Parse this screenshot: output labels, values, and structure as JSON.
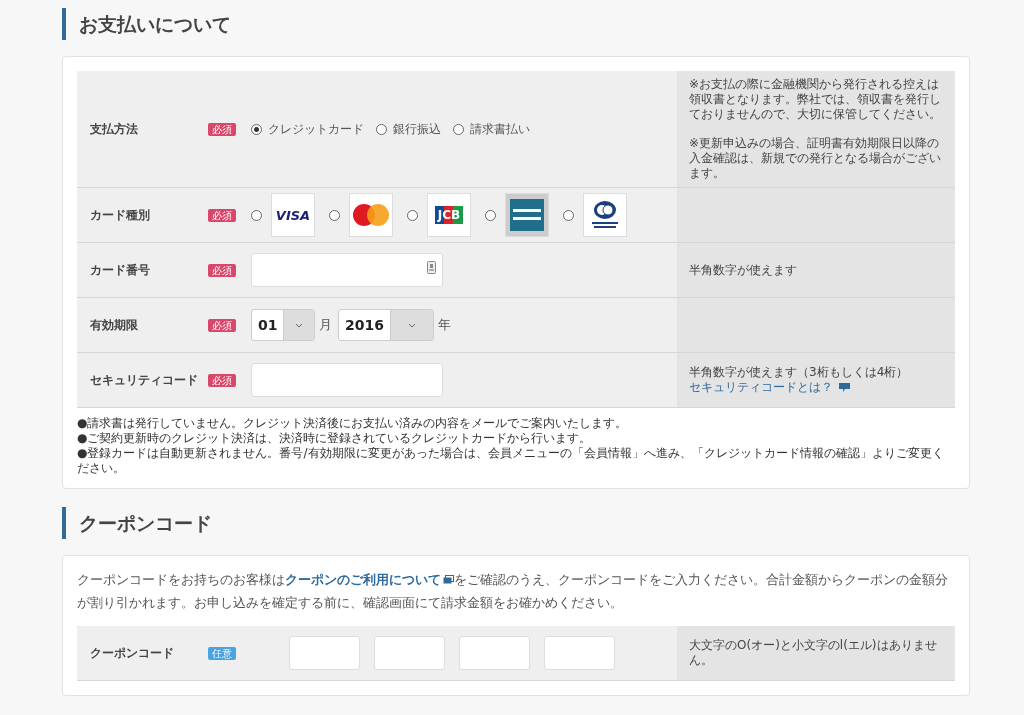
{
  "payment": {
    "title": "お支払いについて",
    "rows": [
      {
        "kind": "radio",
        "label": "支払方法",
        "badge": {
          "kind": "required",
          "text": "必須"
        },
        "options": [
          {
            "label": "クレジットカード",
            "selected": true
          },
          {
            "label": "銀行振込",
            "selected": false
          },
          {
            "label": "請求書払い",
            "selected": false
          }
        ],
        "note": [
          "※お支払の際に金融機関から発行される控えは領収書となります。弊社では、領収書を発行しておりませんので、大切に保管してください。",
          "※更新申込みの場合、証明書有効期限日以降の入金確認は、新規での発行となる場合がございます。"
        ]
      },
      {
        "kind": "cards",
        "label": "カード種別",
        "badge": {
          "kind": "required",
          "text": "必須"
        },
        "cards": [
          {
            "kind": "visa",
            "logo": "VISA",
            "selected": false
          },
          {
            "kind": "master",
            "selected": false
          },
          {
            "kind": "jcb",
            "logo": "JCB",
            "selected": false
          },
          {
            "kind": "amex",
            "selected": false
          },
          {
            "kind": "diners",
            "selected": false
          }
        ]
      },
      {
        "kind": "input",
        "label": "カード番号",
        "badge": {
          "kind": "required",
          "text": "必須"
        },
        "keypad": true,
        "note": [
          "半角数字が使えます"
        ]
      },
      {
        "kind": "expiry",
        "label": "有効期限",
        "badge": {
          "kind": "required",
          "text": "必須"
        },
        "month": "01",
        "month_unit": "月",
        "year": "2016",
        "year_unit": "年"
      },
      {
        "kind": "input",
        "label": "セキュリティコード",
        "badge": {
          "kind": "required",
          "text": "必須"
        },
        "keypad": false,
        "note": [
          "半角数字が使えます（3桁もしくは4桁）"
        ],
        "link": "セキュリティコードとは？"
      }
    ],
    "notes": [
      "●請求書は発行していません。クレジット決済後にお支払い済みの内容をメールでご案内いたします。",
      "●ご契約更新時のクレジット決済は、決済時に登録されているクレジットカードから行います。",
      "●登録カードは自動更新されません。番号/有効期限に変更があった場合は、会員メニューの「会員情報」へ進み、「クレジットカード情報の確認」よりご変更ください。"
    ]
  },
  "coupon": {
    "title": "クーポンコード",
    "intro": {
      "before": "クーポンコードをお持ちのお客様は",
      "link": "クーポンのご利用について",
      "after": "をご確認のうえ、クーポンコードをご入力ください。合計金額からクーポンの金額分が割り引かれます。お申し込みを確定する前に、確認画面にて請求金額をお確かめください。"
    },
    "row": {
      "label": "クーポンコード",
      "badge": {
        "kind": "optional",
        "text": "任意"
      },
      "fields": [
        {
          "kind": "text"
        },
        {
          "kind": "text"
        },
        {
          "kind": "text"
        },
        {
          "kind": "text"
        }
      ],
      "note": [
        "大文字のO(オー)と小文字のl(エル)はありません。"
      ]
    }
  }
}
